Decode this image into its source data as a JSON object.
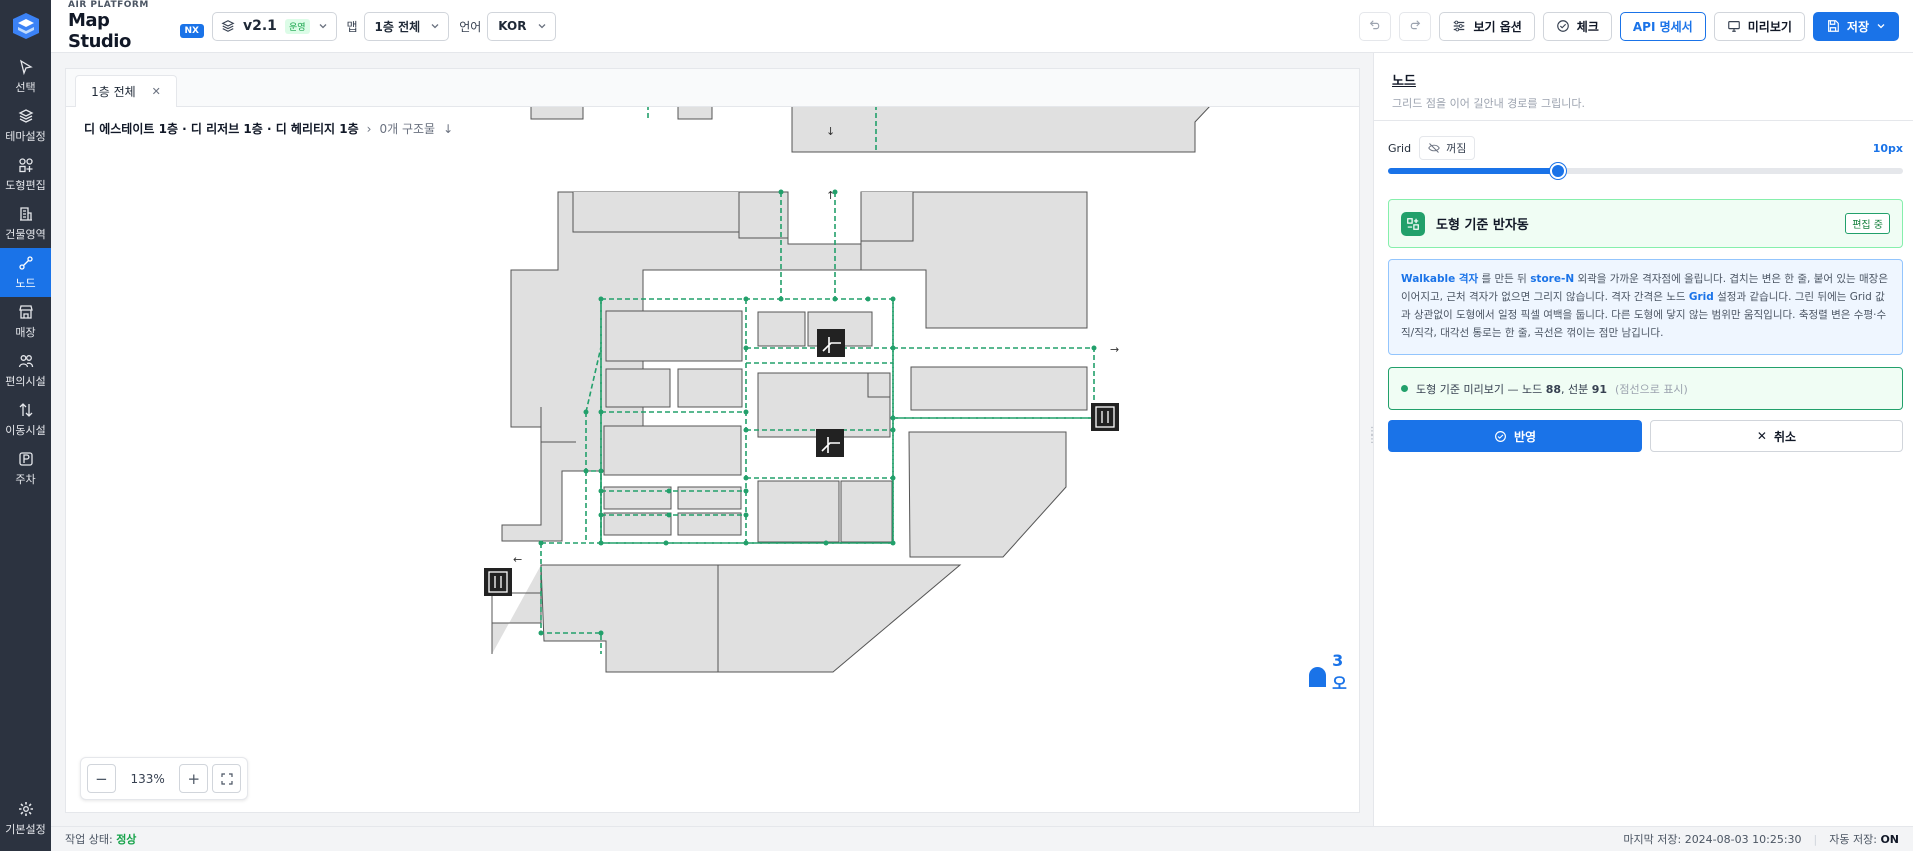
{
  "brand": {
    "subtitle": "AIR PLATFORM",
    "title": "Map Studio",
    "badge": "NX"
  },
  "rail": {
    "items": [
      {
        "label": "선택",
        "icon": "pointer-icon"
      },
      {
        "label": "테마설정",
        "icon": "layers-icon"
      },
      {
        "label": "도형편집",
        "icon": "shapes-icon"
      },
      {
        "label": "건물영역",
        "icon": "building-icon"
      },
      {
        "label": "노드",
        "icon": "node-icon",
        "active": true
      },
      {
        "label": "매장",
        "icon": "store-icon"
      },
      {
        "label": "편의시설",
        "icon": "people-icon"
      },
      {
        "label": "이동시설",
        "icon": "updown-icon"
      },
      {
        "label": "주차",
        "icon": "parking-icon"
      }
    ],
    "settings_label": "기본설정"
  },
  "toolbar": {
    "version": "v2.1",
    "version_tag": "운영",
    "map_label": "맵",
    "map_value": "1층 전체",
    "lang_label": "언어",
    "lang_value": "KOR",
    "view_options": "보기 옵션",
    "check": "체크",
    "api_spec": "API 명세서",
    "preview": "미리보기",
    "save": "저장"
  },
  "canvas": {
    "tab_label": "1층 전체",
    "breadcrumb": "디 에스테이트 1층 · 디 리저브 1층 · 디 헤리티지 1층",
    "structure_count": "0개 구조물",
    "zoom_value": "133%",
    "people_count": "3 오"
  },
  "panel": {
    "title": "노드",
    "subtitle": "그리드 점을 이어 길안내 경로를 그립니다.",
    "grid_label": "Grid",
    "grid_toggle": "꺼짐",
    "grid_value": "10px",
    "grid_slider_fraction": 0.33,
    "mode_title": "도형 기준 반자동",
    "mode_badge": "편집 중",
    "info": {
      "p1": "Walkable 격자",
      "p2": " 를 만든 뒤 ",
      "p3": "store-N",
      "p4": " 외곽을 가까운 격자점에 올립니다. 겹치는 변은 한 줄, 붙어 있는 매장은 이어지고, 근처 격자가 없으면 그리지 않습니다. 격자 간격은 노드 ",
      "p5": "Grid",
      "p6": " 설정과 같습니다. 그린 뒤에는 Grid 값과 상관없이 도형에서 일정 픽셀 여백을 둡니다. 다른 도형에 닿지 않는 범위만 움직입니다. 축정렬 변은 수평·수직/직각, 대각선 통로는 한 줄, 곡선은 꺾이는 점만 남깁니다."
    },
    "preview_prefix": "도형 기준 미리보기 — 노드 ",
    "preview_nodes": "88",
    "preview_mid": ", 선분 ",
    "preview_segments": "91",
    "preview_note": "(점선으로 표시)",
    "apply": "반영",
    "cancel": "취소"
  },
  "status": {
    "work_label": "작업 상태:",
    "work_value": "정상",
    "last_saved": "마지막 저장: 2024-08-03 10:25:30",
    "autosave_label": "자동 저장:",
    "autosave_value": "ON"
  },
  "colors": {
    "accent": "#1a73e8",
    "rail": "#2c3340",
    "path": "#22a06b"
  }
}
